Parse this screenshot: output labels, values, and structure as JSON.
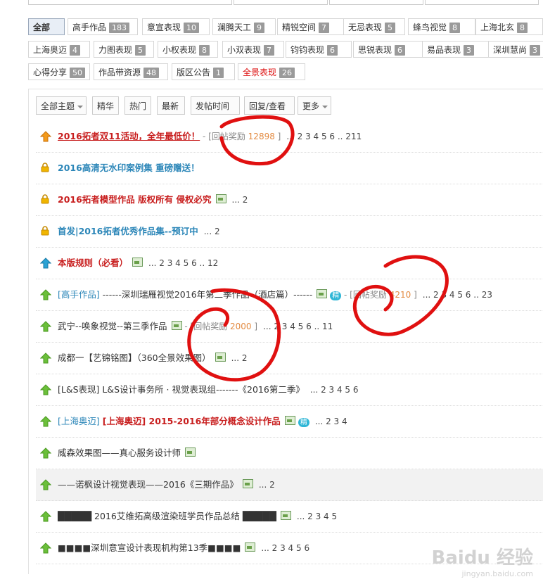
{
  "categories": [
    {
      "label": "全部",
      "count": "",
      "active": true,
      "highlight": false
    },
    {
      "label": "高手作品",
      "count": "183"
    },
    {
      "label": "意宣表现",
      "count": "10"
    },
    {
      "label": "澜腾天工",
      "count": "9"
    },
    {
      "label": "精锐空间",
      "count": "7"
    },
    {
      "label": "无忌表现",
      "count": "5"
    },
    {
      "label": "蜂鸟视觉",
      "count": "8"
    },
    {
      "label": "上海北玄",
      "count": "8"
    },
    {
      "label": "上海奥迈",
      "count": "4"
    },
    {
      "label": "力图表现",
      "count": "5"
    },
    {
      "label": "小权表现",
      "count": "8"
    },
    {
      "label": "小双表现",
      "count": "7"
    },
    {
      "label": "钧钧表现",
      "count": "6"
    },
    {
      "label": "思锐表现",
      "count": "6"
    },
    {
      "label": "易品表现",
      "count": "3"
    },
    {
      "label": "深圳慧尚",
      "count": "3"
    },
    {
      "label": "心得分享",
      "count": "50"
    },
    {
      "label": "作品带资源",
      "count": "48"
    },
    {
      "label": "版区公告",
      "count": "1"
    },
    {
      "label": "全景表现",
      "count": "26",
      "highlight": true
    }
  ],
  "filters": [
    {
      "label": "全部主题",
      "caret": true
    },
    {
      "label": "精华"
    },
    {
      "label": "热门"
    },
    {
      "label": "最新"
    },
    {
      "label": "发帖时间"
    },
    {
      "label": "回复/查看"
    },
    {
      "label": "更多",
      "caret": true
    }
  ],
  "threads": [
    {
      "icon": "pinned-orange",
      "tag": "",
      "title": "2016拓者双11活动，全年最低价！",
      "style": "red",
      "underline": true,
      "img": false,
      "jing": false,
      "reward_label": "回帖奖励",
      "reward_value": "12898",
      "pages": "... 2 3 4 5 6 .. 211"
    },
    {
      "icon": "lock",
      "tag": "",
      "title": "2016高清无水印案例集 重磅赠送！",
      "style": "blue",
      "img": false,
      "jing": false,
      "reward_label": "",
      "reward_value": "",
      "pages": ""
    },
    {
      "icon": "lock",
      "tag": "",
      "title": "2016拓者模型作品 版权所有 侵权必究",
      "style": "red",
      "img": true,
      "jing": false,
      "reward_label": "",
      "reward_value": "",
      "pages": "... 2"
    },
    {
      "icon": "lock",
      "tag": "",
      "title": "首发|2016拓者优秀作品集--预订中",
      "style": "blue",
      "img": false,
      "jing": false,
      "reward_label": "",
      "reward_value": "",
      "pages": "... 2"
    },
    {
      "icon": "pinned-blue",
      "tag": "",
      "title": "本版规则（必看）",
      "style": "red",
      "img": true,
      "jing": false,
      "reward_label": "",
      "reward_value": "",
      "pages": "... 2 3 4 5 6 .. 12"
    },
    {
      "icon": "normal",
      "tag": "[高手作品]",
      "title": "------深圳瑞雁视觉2016年第二季作品（酒店篇）------",
      "style": "norm",
      "img": true,
      "jing": true,
      "reward_label": "回帖奖励",
      "reward_value": "4210",
      "pages": "... 2 3 4 5 6 .. 23"
    },
    {
      "icon": "normal",
      "tag": "",
      "title": "武宁--唤象视觉--第三季作品",
      "style": "norm",
      "img": true,
      "jing": false,
      "reward_label": "回帖奖励",
      "reward_value": "2000",
      "pages": "... 2 3 4 5 6 .. 11"
    },
    {
      "icon": "normal",
      "tag": "",
      "title": "成都一【艺锦铭图】（360全景效果图）",
      "style": "norm",
      "img": true,
      "jing": false,
      "reward_label": "",
      "reward_value": "",
      "pages": "... 2"
    },
    {
      "icon": "normal",
      "tag": "",
      "title": "[L&S表现] L&S设计事务所 · 视觉表现组-------《2016第二季》",
      "style": "norm",
      "img": false,
      "jing": false,
      "reward_label": "",
      "reward_value": "",
      "pages": "... 2 3 4 5 6"
    },
    {
      "icon": "normal",
      "tag": "[上海奥迈]",
      "title": "[上海奥迈] 2015-2016年部分概念设计作品",
      "style": "red",
      "img": true,
      "jing": true,
      "reward_label": "",
      "reward_value": "",
      "pages": "... 2 3 4"
    },
    {
      "icon": "normal",
      "tag": "",
      "title": "威森效果图——真心服务设计师",
      "style": "norm",
      "img": true,
      "jing": false,
      "reward_label": "",
      "reward_value": "",
      "pages": ""
    },
    {
      "icon": "normal",
      "tag": "",
      "title": "——诺枫设计视觉表现——2016《三期作品》",
      "style": "norm",
      "alt": true,
      "img": true,
      "jing": false,
      "reward_label": "",
      "reward_value": "",
      "pages": "... 2"
    },
    {
      "icon": "normal",
      "tag": "",
      "title": "█████ 2016艾维拓高级渲染班学员作品总结 █████",
      "style": "norm",
      "img": true,
      "jing": false,
      "reward_label": "",
      "reward_value": "",
      "pages": "... 2 3 4 5"
    },
    {
      "icon": "normal",
      "tag": "",
      "title": "■■■■深圳意宣设计表现机构第13季■■■■",
      "style": "norm",
      "img": true,
      "jing": false,
      "reward_label": "",
      "reward_value": "",
      "pages": "... 2 3 4 5 6"
    }
  ],
  "jing_label": "精",
  "watermark": {
    "brand": "Baidu 经验",
    "sub": "jingyan.baidu.com"
  },
  "colors": {
    "red": "#c81e1e",
    "blue": "#2b86b8",
    "reward": "#e38b42",
    "annotation": "#e01010"
  }
}
